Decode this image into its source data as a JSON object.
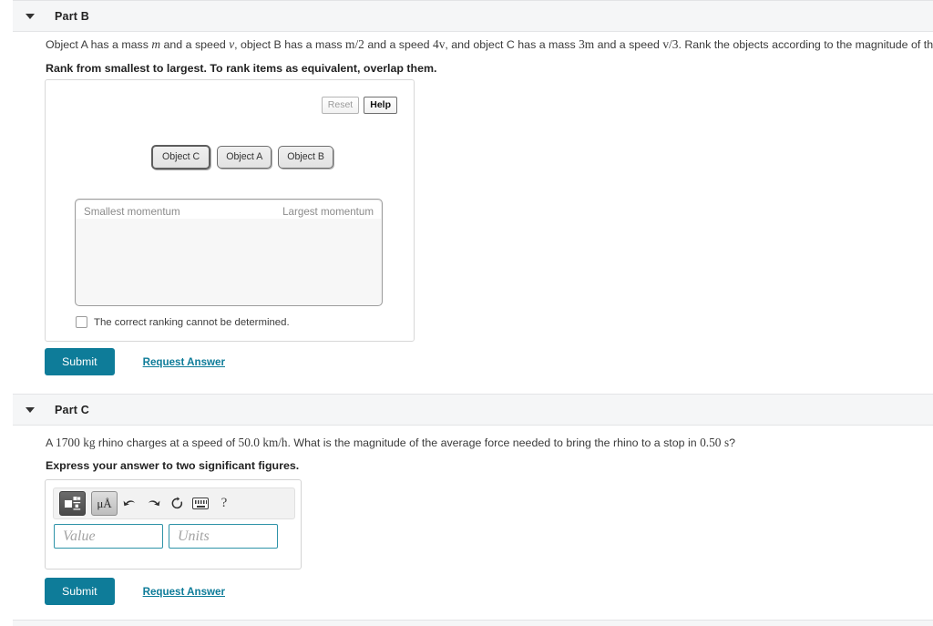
{
  "part_b": {
    "title": "Part B",
    "caret_icon": "caret-down-icon",
    "question_pre": "Object A has a mass ",
    "q_m": "m",
    "question_2": " and a speed ",
    "q_v": "v",
    "question_3": ", object B has a mass ",
    "q_m2": "m/2",
    "question_4": " and a speed ",
    "q_4v": "4v",
    "question_5": ", and object C has a mass ",
    "q_3m": "3m",
    "question_6": " and a speed ",
    "q_v3": "v/3",
    "question_7": ". Rank the objects according to the magnitude of their momentum",
    "instruction": "Rank from smallest to largest. To rank items as equivalent, overlap them.",
    "reset_label": "Reset",
    "help_label": "Help",
    "tiles": [
      {
        "label": "Object C"
      },
      {
        "label": "Object A"
      },
      {
        "label": "Object B"
      }
    ],
    "dropzone_left_label": "Smallest momentum",
    "dropzone_right_label": "Largest momentum",
    "cannot_determine_label": "The correct ranking cannot be determined.",
    "submit_label": "Submit",
    "request_answer_label": "Request Answer"
  },
  "part_c": {
    "title": "Part C",
    "caret_icon": "caret-down-icon",
    "question_pre": "A ",
    "q_1700": "1700",
    "q_kg": "kg",
    "question_2": " rhino charges at a speed of ",
    "q_speed": "50.0",
    "q_kmh": "km/h",
    "question_3": ". What is the magnitude of the average force needed to bring the rhino to a stop in ",
    "q_time": "0.50",
    "q_s": "s",
    "question_4": "?",
    "instruction": "Express your answer to two significant figures.",
    "toolbar": {
      "template_icon": "math-template-icon",
      "units_icon": "micro-angstrom-units-icon",
      "units_glyph": "μÅ",
      "undo_icon": "undo-arrow-icon",
      "redo_icon": "redo-arrow-icon",
      "reset_icon": "reset-circular-arrow-icon",
      "keyboard_icon": "keyboard-icon",
      "help_icon": "question-mark-icon",
      "help_glyph": "?"
    },
    "value_placeholder": "Value",
    "units_placeholder": "Units",
    "submit_label": "Submit",
    "request_answer_label": "Request Answer"
  },
  "colors": {
    "accent": "#0e7c99",
    "header_bg": "#f5f6f7",
    "field_border": "#2e93a8"
  }
}
